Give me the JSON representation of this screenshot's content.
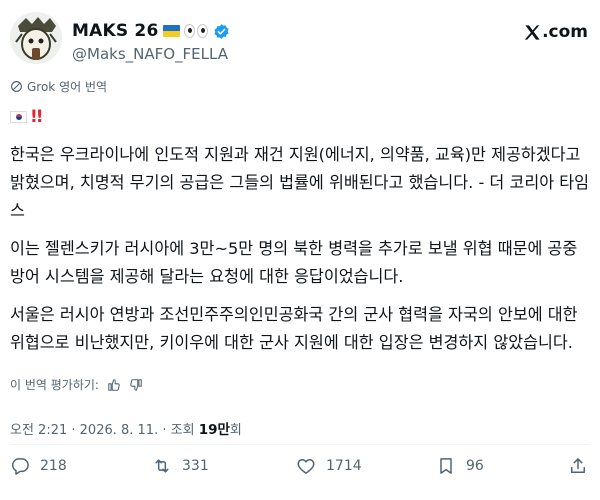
{
  "author": {
    "display_name": "MAKS 26",
    "handle": "@Maks_NAFO_FELLA",
    "flag": "ukraine-flag",
    "verified": true
  },
  "platform_logo": ".com",
  "translate_label": "Grok 영어 번역",
  "paragraphs": [
    "한국은 우크라이나에 인도적 지원과 재건 지원(에너지, 의약품, 교육)만 제공하겠다고 밝혔으며, 치명적 무기의 공급은 그들의 법률에 위배된다고 했습니다. - 더 코리아 타임스",
    "이는 젤렌스키가 러시아에 3만~5만 명의 북한 병력을 추가로 보낼 위협 때문에 공중방어 시스템을 제공해 달라는 요청에 대한 응답이었습니다.",
    "서울은 러시아 연방과 조선민주주의인민공화국 간의 군사 협력을 자국의 안보에 대한 위협으로 비난했지만, 키이우에 대한 군사 지원에 대한 입장은 변경하지 않았습니다."
  ],
  "rate_label": "이 번역 평가하기:",
  "meta": {
    "time": "오전 2:21",
    "date": "2026. 8. 11.",
    "views_prefix": "조회",
    "views_count": "19만",
    "views_suffix": "회"
  },
  "actions": {
    "replies": "218",
    "reposts": "331",
    "likes": "1714",
    "bookmarks": "96"
  },
  "colors": {
    "text_primary": "#0f1419",
    "text_secondary": "#536471",
    "verified_blue": "#1d9bf0",
    "divider": "#eff3f4"
  }
}
